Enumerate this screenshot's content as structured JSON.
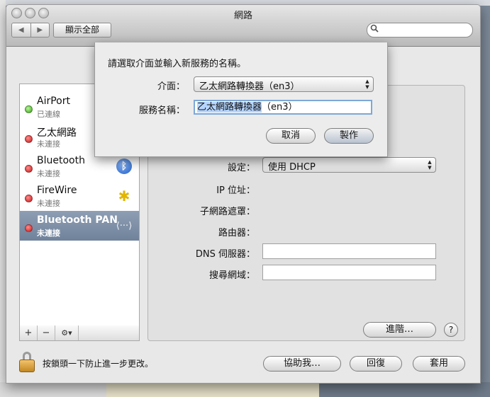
{
  "window": {
    "title": "網路",
    "show_all": "顯示全部"
  },
  "nav": {
    "back": "◀",
    "forward": "▶"
  },
  "services": [
    {
      "name": "AirPort",
      "status": "已連線",
      "state": "green",
      "icon": "airport-icon"
    },
    {
      "name": "乙太網路",
      "status": "未連接",
      "state": "red",
      "icon": "ethernet-icon"
    },
    {
      "name": "Bluetooth",
      "status": "未連接",
      "state": "red",
      "icon": "bluetooth-icon"
    },
    {
      "name": "FireWire",
      "status": "未連接",
      "state": "red",
      "icon": "firewire-icon"
    },
    {
      "name": "Bluetooth PAN",
      "status": "未連接",
      "state": "red",
      "icon": "bluetooth-pan-icon",
      "selected": true
    }
  ],
  "list_controls": {
    "add": "+",
    "remove": "−",
    "gear": "⚙▾"
  },
  "detail": {
    "config_label": "設定：",
    "config_value": "使用 DHCP",
    "ip_label": "IP 位址：",
    "subnet_label": "子網路遮罩：",
    "router_label": "路由器：",
    "dns_label": "DNS 伺服器：",
    "search_domain_label": "搜尋網域：",
    "advanced_button": "進階…",
    "help_button": "?"
  },
  "footer": {
    "lock_text": "按鎖頭一下防止進一步更改。",
    "assist_button": "協助我…",
    "revert_button": "回復",
    "apply_button": "套用"
  },
  "sheet": {
    "prompt": "請選取介面並輸入新服務的名稱。",
    "interface_label": "介面：",
    "interface_value": "乙太網路轉換器（en3）",
    "service_name_label": "服務名稱：",
    "service_name_value": "乙太網路轉換器",
    "service_name_suffix": "（en3）",
    "cancel_button": "取消",
    "create_button": "製作"
  },
  "colors": {
    "selection": "#7a8ba3",
    "default_button": "#b9c3d1"
  }
}
